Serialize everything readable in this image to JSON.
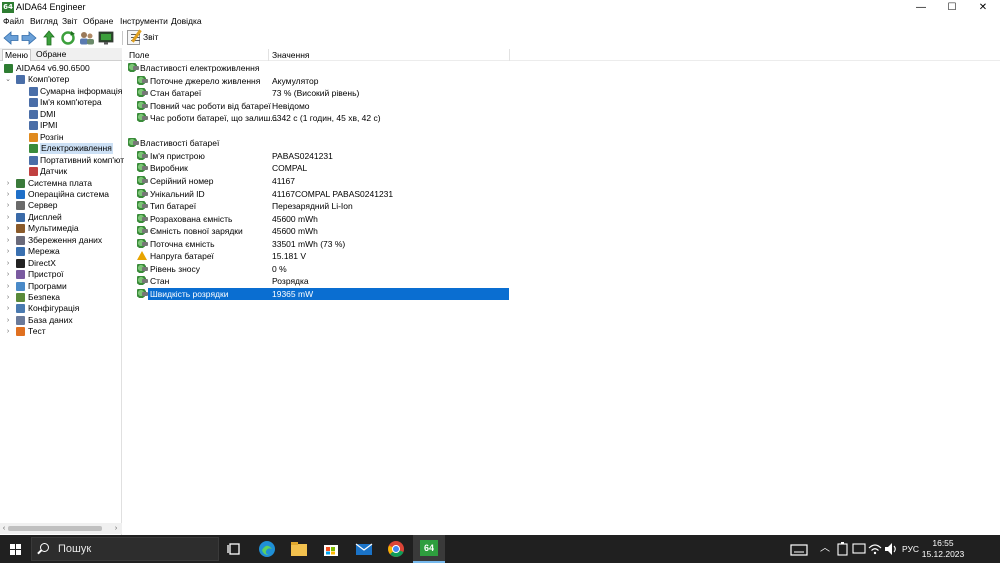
{
  "window": {
    "app_icon_text": "64",
    "title": "AIDA64 Engineer",
    "minimize": "—",
    "maximize": "☐",
    "close": "✕"
  },
  "menu": [
    "Файл",
    "Вигляд",
    "Звіт",
    "Обране",
    "Інструменти",
    "Довідка"
  ],
  "toolbar": {
    "report_label": "Звіт"
  },
  "left_panel": {
    "tabs": [
      "Меню",
      "Обране"
    ],
    "tree": [
      {
        "label": "AIDA64 v6.90.6500",
        "icon": "aida-icon",
        "level": 0,
        "arrow": ""
      },
      {
        "label": "Комп'ютер",
        "icon": "computer-icon",
        "level": 0,
        "arrow": "⌄"
      },
      {
        "label": "Сумарна інформація",
        "icon": "summary-icon",
        "level": 1,
        "arrow": ""
      },
      {
        "label": "Ім'я комп'ютера",
        "icon": "computer-name-icon",
        "level": 1,
        "arrow": ""
      },
      {
        "label": "DMI",
        "icon": "dmi-icon",
        "level": 1,
        "arrow": ""
      },
      {
        "label": "IPMI",
        "icon": "ipmi-icon",
        "level": 1,
        "arrow": ""
      },
      {
        "label": "Розгін",
        "icon": "overclock-icon",
        "level": 1,
        "arrow": ""
      },
      {
        "label": "Електроживлення",
        "icon": "power-icon",
        "level": 1,
        "arrow": "",
        "selected": true
      },
      {
        "label": "Портативний комп'ют",
        "icon": "portable-icon",
        "level": 1,
        "arrow": ""
      },
      {
        "label": "Датчик",
        "icon": "sensor-icon",
        "level": 1,
        "arrow": ""
      },
      {
        "label": "Системна плата",
        "icon": "motherboard-icon",
        "level": 0,
        "arrow": "›"
      },
      {
        "label": "Операційна система",
        "icon": "os-icon",
        "level": 0,
        "arrow": "›"
      },
      {
        "label": "Сервер",
        "icon": "server-icon",
        "level": 0,
        "arrow": "›"
      },
      {
        "label": "Дисплей",
        "icon": "display-icon",
        "level": 0,
        "arrow": "›"
      },
      {
        "label": "Мультимедіа",
        "icon": "multimedia-icon",
        "level": 0,
        "arrow": "›"
      },
      {
        "label": "Збереження даних",
        "icon": "storage-icon",
        "level": 0,
        "arrow": "›"
      },
      {
        "label": "Мережа",
        "icon": "network-icon",
        "level": 0,
        "arrow": "›"
      },
      {
        "label": "DirectX",
        "icon": "directx-icon",
        "level": 0,
        "arrow": "›"
      },
      {
        "label": "Пристрої",
        "icon": "devices-icon",
        "level": 0,
        "arrow": "›"
      },
      {
        "label": "Програми",
        "icon": "programs-icon",
        "level": 0,
        "arrow": "›"
      },
      {
        "label": "Безпека",
        "icon": "security-icon",
        "level": 0,
        "arrow": "›"
      },
      {
        "label": "Конфігурація",
        "icon": "config-icon",
        "level": 0,
        "arrow": "›"
      },
      {
        "label": "База даних",
        "icon": "database-icon",
        "level": 0,
        "arrow": "›"
      },
      {
        "label": "Тест",
        "icon": "test-icon",
        "level": 0,
        "arrow": "›"
      }
    ]
  },
  "grid": {
    "columns": [
      "Поле",
      "Значення"
    ],
    "rows": [
      {
        "type": "group",
        "field": "Властивості електроживлення",
        "value": "",
        "icon": "battery-icon"
      },
      {
        "type": "item",
        "field": "Поточне джерело живлення",
        "value": "Акумулятор",
        "icon": "battery-icon"
      },
      {
        "type": "item",
        "field": "Стан батареї",
        "value": "73 % (Високий рівень)",
        "icon": "battery-icon"
      },
      {
        "type": "item",
        "field": "Повний час роботи від батареї",
        "value": "Невідомо",
        "icon": "battery-icon"
      },
      {
        "type": "item",
        "field": "Час роботи батареї, що залиш...",
        "value": "6342 с (1 годин, 45 хв, 42 с)",
        "icon": "battery-icon"
      },
      {
        "type": "blank",
        "field": "",
        "value": "",
        "icon": ""
      },
      {
        "type": "group",
        "field": "Властивості батареї",
        "value": "",
        "icon": "battery-icon"
      },
      {
        "type": "item",
        "field": "Ім'я пристрою",
        "value": "PABAS0241231",
        "icon": "battery-icon"
      },
      {
        "type": "item",
        "field": "Виробник",
        "value": "COMPAL",
        "icon": "battery-icon"
      },
      {
        "type": "item",
        "field": "Серійний номер",
        "value": "41167",
        "icon": "battery-icon"
      },
      {
        "type": "item",
        "field": "Унікальний ID",
        "value": "41167COMPAL PABAS0241231",
        "icon": "battery-icon"
      },
      {
        "type": "item",
        "field": "Тип батареї",
        "value": "Перезарядний Li-Ion",
        "icon": "battery-icon"
      },
      {
        "type": "item",
        "field": "Розрахована ємність",
        "value": "45600 mWh",
        "icon": "battery-icon"
      },
      {
        "type": "item",
        "field": "Ємність повної зарядки",
        "value": "45600 mWh",
        "icon": "battery-icon"
      },
      {
        "type": "item",
        "field": "Поточна ємність",
        "value": "33501 mWh  (73 %)",
        "icon": "battery-icon"
      },
      {
        "type": "item",
        "field": "Напруга батареї",
        "value": "15.181 V",
        "icon": "warning-icon"
      },
      {
        "type": "item",
        "field": "Рівень зносу",
        "value": "0 %",
        "icon": "battery-icon"
      },
      {
        "type": "item",
        "field": "Стан",
        "value": "Розрядка",
        "icon": "battery-icon"
      },
      {
        "type": "item",
        "field": "Швидкість розрядки",
        "value": "19365 mW",
        "icon": "battery-icon",
        "selected": true
      }
    ]
  },
  "taskbar": {
    "search_placeholder": "Пошук",
    "language": "РУС",
    "time": "16:55",
    "date": "15.12.2023",
    "active_app_label": "64",
    "apps": [
      "task-view-icon",
      "edge-icon",
      "file-explorer-icon",
      "store-icon",
      "mail-icon",
      "chrome-icon",
      "aida64-icon"
    ]
  },
  "colors": {
    "selection": "#0a6ed1",
    "tree_selection": "#cce0f5",
    "taskbar": "#202020",
    "accent": "#76b9ed"
  }
}
